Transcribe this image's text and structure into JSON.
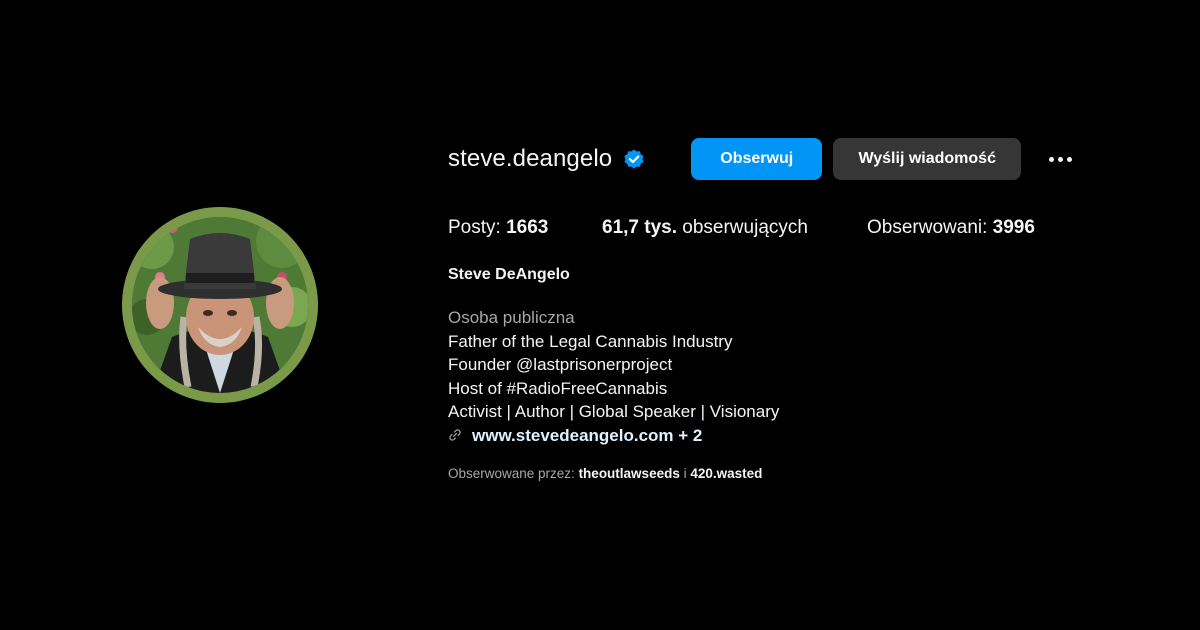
{
  "profile": {
    "username": "steve.deangelo",
    "verified_icon": "verified-badge-icon",
    "accent_color": "#0095f6",
    "ring_color": "#7a9a4a",
    "avatar_alt": "Steve DeAngelo",
    "follow_label": "Obserwuj",
    "message_label": "Wyślij wiadomość",
    "more_icon": "more-options-icon"
  },
  "stats": {
    "posts_label": "Posty: ",
    "posts_value": "1663",
    "followers_value": "61,7 tys.",
    "followers_label": " obserwujących",
    "following_label": "Obserwowani: ",
    "following_value": "3996"
  },
  "bio": {
    "full_name": "Steve DeAngelo",
    "category": "Osoba publiczna",
    "lines": [
      "Father of the Legal Cannabis Industry",
      "Founder @lastprisonerproject",
      "Host of #RadioFreeCannabis",
      "Activist | Author | Global Speaker | Visionary"
    ],
    "link_icon": "link-icon",
    "link_text": "www.stevedeangelo.com + 2"
  },
  "followed_by": {
    "prefix": "Obserwowane przez: ",
    "user1": "theoutlawseeds",
    "separator": " i ",
    "user2": "420.wasted"
  }
}
